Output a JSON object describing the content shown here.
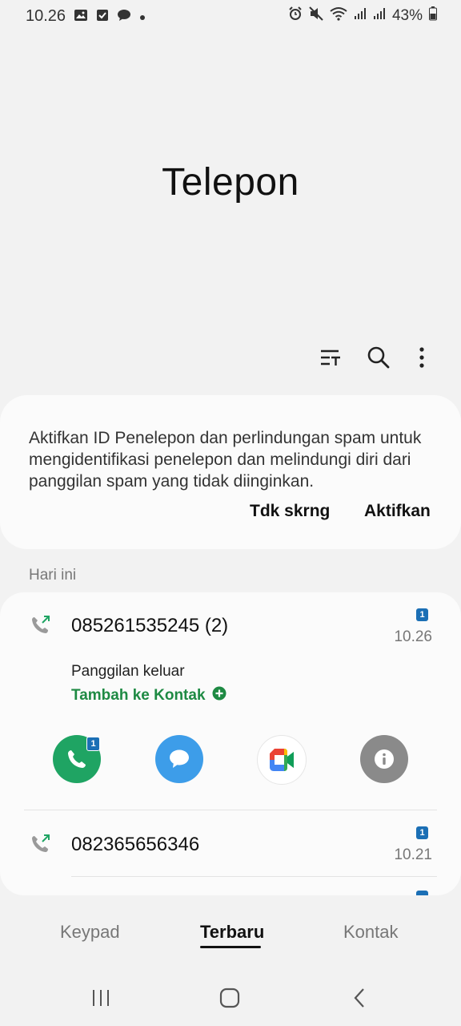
{
  "status_bar": {
    "time": "10.26",
    "battery": "43%",
    "left_icons": [
      "gallery-icon",
      "checkbox-icon",
      "chat-bubble-icon",
      "dot-icon"
    ],
    "right_icons": [
      "alarm-icon",
      "mute-icon",
      "wifi-icon",
      "signal-icon",
      "signal-icon",
      "battery-icon"
    ]
  },
  "title": "Telepon",
  "toolbar": {
    "icons": [
      "filter-icon",
      "search-icon",
      "more-vert-icon"
    ]
  },
  "spam_card": {
    "message": "Aktifkan ID Penelepon dan perlindungan spam untuk mengidentifikasi penelepon dan melindungi diri dari panggilan spam yang tidak diinginkan.",
    "dismiss_label": "Tdk skrng",
    "enable_label": "Aktifkan"
  },
  "section": {
    "label": "Hari ini"
  },
  "calls": [
    {
      "number": "085261535245 (2)",
      "sim": "1",
      "time": "10.26",
      "type": "Panggilan keluar",
      "add_contact": "Tambah ke Kontak",
      "expanded": true
    },
    {
      "number": "082365656346",
      "sim": "1",
      "time": "10.21",
      "expanded": false
    }
  ],
  "actions": {
    "call_sim_badge": "1",
    "items": [
      "phone-icon",
      "message-icon",
      "meet-video-icon",
      "info-icon"
    ]
  },
  "tabs": [
    {
      "label": "Keypad",
      "active": false
    },
    {
      "label": "Terbaru",
      "active": true
    },
    {
      "label": "Kontak",
      "active": false
    }
  ],
  "colors": {
    "accent_green": "#1e8a43",
    "call_green": "#1fa463",
    "message_blue": "#3d9de9",
    "info_gray": "#8a8a8a",
    "sim_blue": "#1b6fb5"
  }
}
